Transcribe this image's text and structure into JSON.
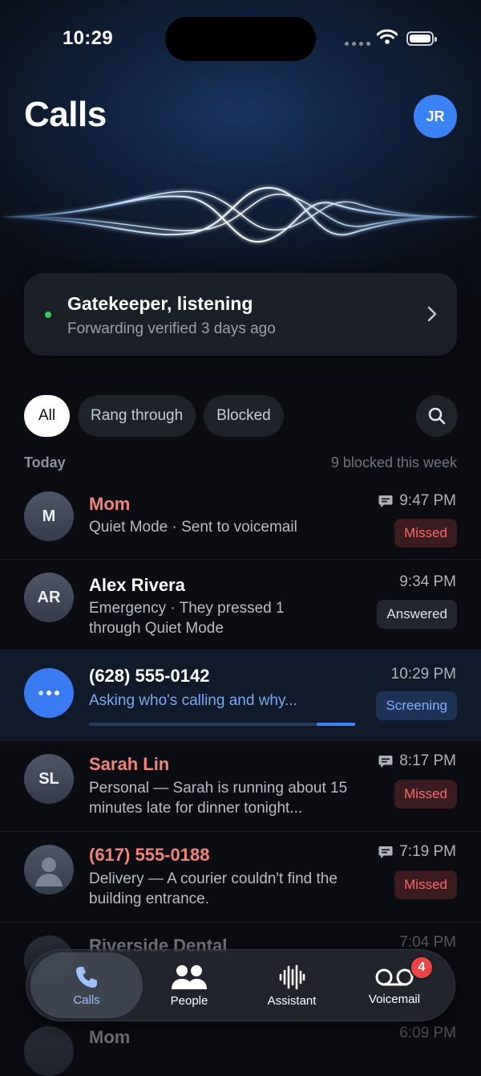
{
  "status": {
    "time": "10:29"
  },
  "header": {
    "title": "Calls",
    "avatar_initials": "JR"
  },
  "gatekeeper": {
    "title": "Gatekeeper, listening",
    "subtitle": "Forwarding verified 3 days ago",
    "status_color": "#34c759"
  },
  "filters": [
    {
      "label": "All",
      "active": true
    },
    {
      "label": "Rang through"
    },
    {
      "label": "Blocked"
    }
  ],
  "section": {
    "label": "Today",
    "summary": "9 blocked this week"
  },
  "calls": [
    {
      "initials": "M",
      "name": "Mom",
      "name_color": "red",
      "description": "Quiet Mode · Sent to voicemail",
      "time": "9:47 PM",
      "has_message": true,
      "status": "Missed"
    },
    {
      "initials": "AR",
      "name": "Alex Rivera",
      "description": "Emergency · They pressed 1 through Quiet Mode",
      "time": "9:34 PM",
      "status": "Answered"
    },
    {
      "initials": "",
      "name": "(628) 555-0142",
      "description": "Asking who's calling and why...",
      "time": "10:29 PM",
      "status": "Screening",
      "progress": 0.86
    },
    {
      "initials": "SL",
      "name": "Sarah Lin",
      "name_color": "red",
      "description": "Personal — Sarah is running about 15 minutes late for dinner tonight...",
      "time": "8:17 PM",
      "has_message": true,
      "status": "Missed"
    },
    {
      "initials": "",
      "name": "(617) 555-0188",
      "name_color": "red",
      "description": "Delivery — A courier couldn't find the building entrance.",
      "time": "7:19 PM",
      "has_message": true,
      "status": "Missed"
    },
    {
      "name": "Riverside Dental",
      "time": "7:04 PM"
    },
    {
      "name": "Mom",
      "time": "6:09 PM"
    }
  ],
  "tabbar": [
    {
      "label": "Calls",
      "icon": "phone-icon",
      "active": true
    },
    {
      "label": "People",
      "icon": "people-icon"
    },
    {
      "label": "Assistant",
      "icon": "waveform-icon"
    },
    {
      "label": "Voicemail",
      "icon": "voicemail-icon",
      "badge": "4"
    }
  ],
  "colors": {
    "accent": "#3b82f6",
    "missed": "#ef6d6a",
    "background": "#0b0d12"
  }
}
